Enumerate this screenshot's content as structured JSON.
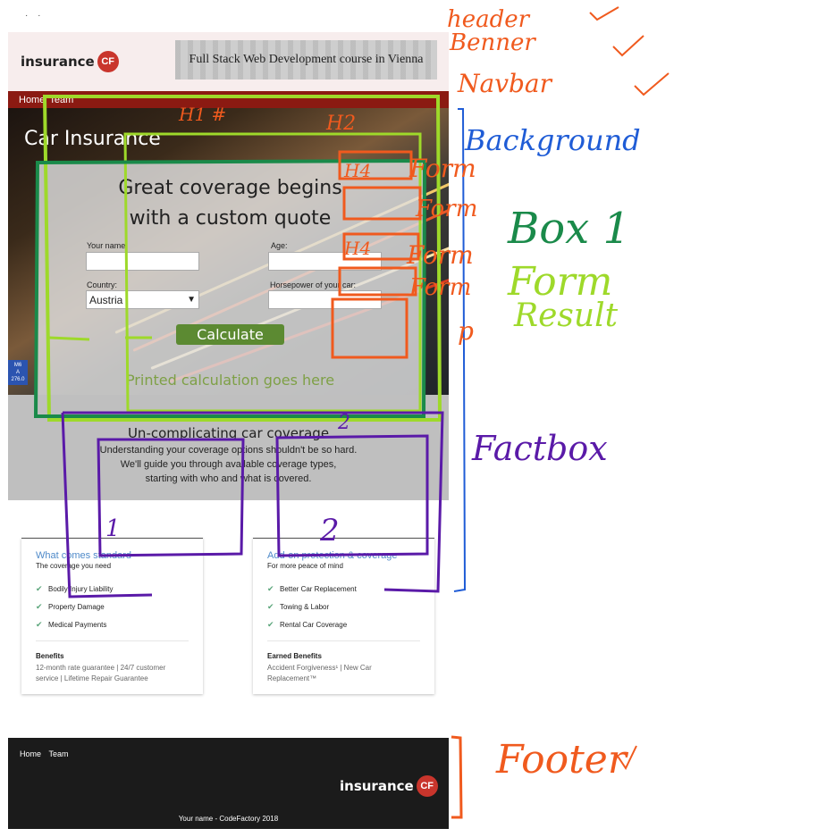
{
  "top_marks": "· ·",
  "header": {
    "logo_text": "insurance",
    "logo_badge": "CF",
    "banner_text": "Full Stack Web Development course in Vienna"
  },
  "navbar": {
    "links": [
      "Home",
      "Team"
    ]
  },
  "hero": {
    "title": "Car Insurance",
    "sign_lines": [
      "M6",
      "A",
      "276.0"
    ]
  },
  "form": {
    "heading_line1": "Great coverage begins",
    "heading_line2": "with a custom quote",
    "name_label": "Your name:",
    "age_label": "Age:",
    "country_label": "Country:",
    "country_value": "Austria",
    "horsepower_label": "Horsepower of your car:",
    "calculate_label": "Calculate",
    "result_text": "Printed calculation goes here"
  },
  "factbox": {
    "title": "Un-complicating car coverage",
    "line1": "Understanding your coverage options shouldn't be so hard.",
    "line2": "We'll guide you through available coverage types,",
    "line3": "starting with who and what is covered."
  },
  "cards": [
    {
      "title": "What comes standard",
      "subtitle": "The coverage you need",
      "items": [
        "Bodily Injury Liability",
        "Property Damage",
        "Medical Payments"
      ],
      "benefit_title": "Benefits",
      "benefit_text": "12-month rate guarantee | 24/7 customer service | Lifetime Repair Guarantee"
    },
    {
      "title": "Add-on protection & coverage",
      "subtitle": "For more peace of mind",
      "items": [
        "Better Car Replacement",
        "Towing & Labor",
        "Rental Car Coverage"
      ],
      "benefit_title": "Earned Benefits",
      "benefit_text": "Accident Forgiveness¹ | New Car Replacement™"
    }
  ],
  "footer": {
    "links": [
      "Home",
      "Team"
    ],
    "logo_text": "insurance",
    "logo_badge": "CF",
    "copyright": "Your name - CodeFactory 2018"
  },
  "annotations": {
    "header": "header",
    "banner": "Benner",
    "navbar": "Navbar",
    "background": "Background",
    "form1": "Form",
    "form2": "Form",
    "form3": "Form",
    "form4": "Form",
    "box1": "Box 1",
    "form_green": "Form",
    "result": "Result",
    "p": "p",
    "factbox": "Factbox",
    "footer": "Footer",
    "h1": "H1 #",
    "h2": "H2",
    "h4a": "H4",
    "h4b": "H4",
    "num1": "1",
    "num2": "2",
    "num2b": "2",
    "colors": {
      "orange": "#f05a1e",
      "blue": "#1f5cd6",
      "green": "#1a8a4a",
      "lime": "#9ed92a",
      "purple": "#5a1aa8"
    }
  }
}
